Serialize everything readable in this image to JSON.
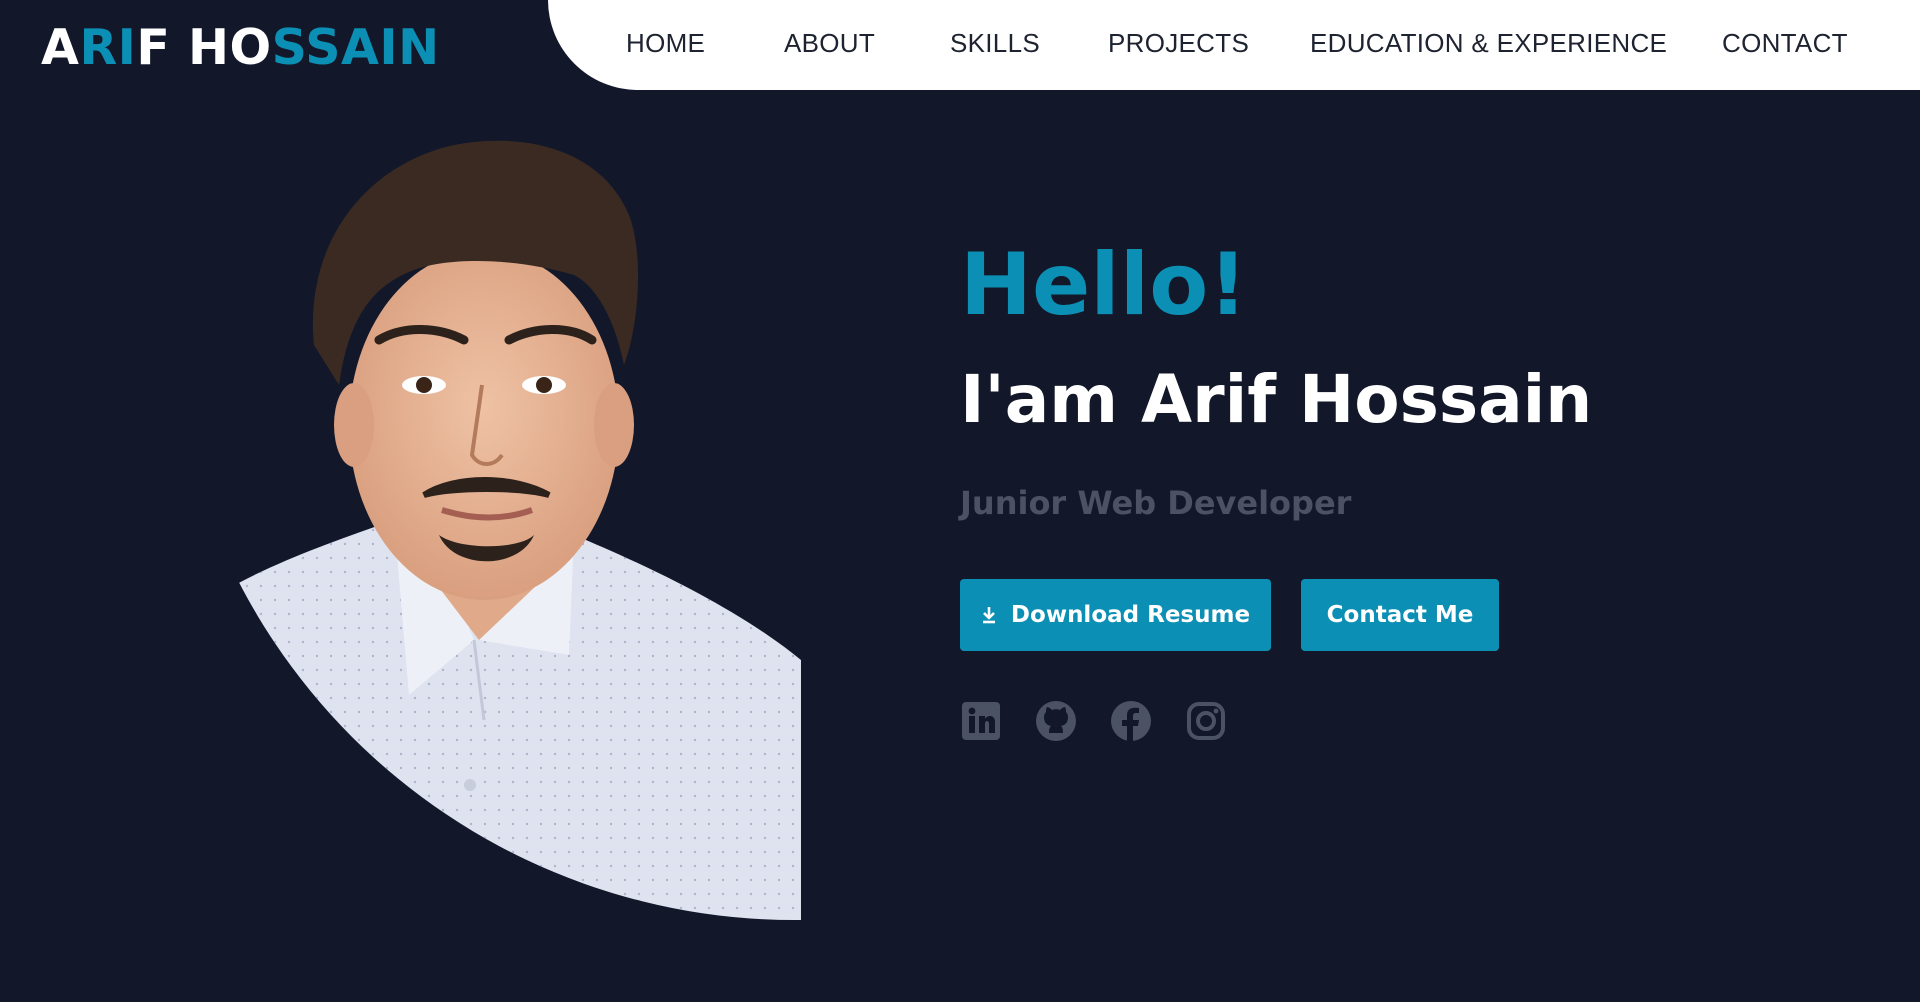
{
  "logo": {
    "parts": [
      {
        "text": "A",
        "tone": "white"
      },
      {
        "text": "RI",
        "tone": "blue"
      },
      {
        "text": "F HO",
        "tone": "white"
      },
      {
        "text": "SSAIN",
        "tone": "blue"
      }
    ]
  },
  "nav": {
    "items": [
      {
        "label": "HOME"
      },
      {
        "label": "ABOUT"
      },
      {
        "label": "SKILLS"
      },
      {
        "label": "PROJECTS"
      },
      {
        "label": "EDUCATION & EXPERIENCE"
      },
      {
        "label": "CONTACT"
      }
    ]
  },
  "hero": {
    "greeting": "Hello!",
    "name": "I'am Arif Hossain",
    "role": "Junior Web Developer",
    "download_button": "Download Resume",
    "contact_button": "Contact Me"
  },
  "socials": [
    {
      "icon": "linkedin-icon"
    },
    {
      "icon": "github-icon"
    },
    {
      "icon": "facebook-icon"
    },
    {
      "icon": "instagram-icon"
    }
  ],
  "colors": {
    "background": "#12182a",
    "accent": "#0b8fb4",
    "nav_background": "#ffffff",
    "muted_text": "#4a5263"
  }
}
